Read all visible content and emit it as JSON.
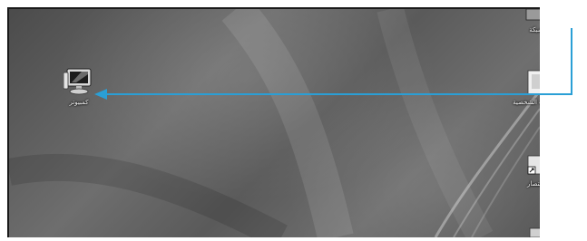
{
  "colors": {
    "arrow": "#2a9fd6",
    "frame": "#1a1a1a"
  },
  "desktop": {
    "icons": [
      {
        "name": "computer-icon",
        "label": "كمبيوتر"
      },
      {
        "name": "network-icon",
        "label": "شبكة"
      },
      {
        "name": "folder-icon",
        "label": "الملفات الشخصية"
      },
      {
        "name": "shortcut-icon",
        "label": "اختصار"
      },
      {
        "name": "recycle-bin-icon",
        "label": ""
      }
    ]
  }
}
